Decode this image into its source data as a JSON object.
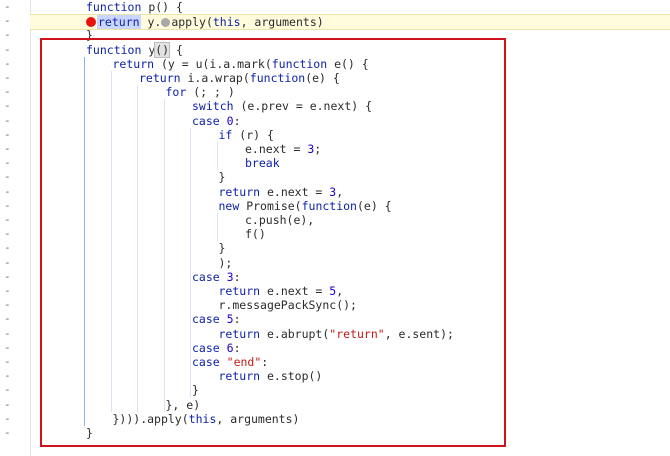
{
  "editor": {
    "gutter_marker": "-",
    "highlight_box_color": "#d0121f",
    "breakpoint_color": "#e8130f",
    "lines": [
      {
        "segments": [
          {
            "t": "function",
            "c": "kwb"
          },
          {
            "t": " p() {",
            "c": "fn"
          }
        ]
      },
      {
        "paused": true,
        "segments": [
          {
            "t": "return",
            "c": "hl-return"
          },
          {
            "t": " y.",
            "c": "fn"
          },
          {
            "t": "apply(",
            "c": "fn"
          },
          {
            "t": "this",
            "c": "kwb"
          },
          {
            "t": ", arguments)",
            "c": "fn"
          }
        ]
      },
      {
        "segments": [
          {
            "t": "}",
            "c": "fn"
          }
        ]
      },
      {
        "segments": [
          {
            "t": "function",
            "c": "kwb"
          },
          {
            "t": " y",
            "c": "fn"
          },
          {
            "t": "()",
            "c": "hl-paren"
          },
          {
            "t": " {",
            "c": "fn"
          }
        ]
      },
      {
        "segments": [
          {
            "t": "return",
            "c": "kwb"
          },
          {
            "t": " (y = u(i.a.mark(",
            "c": "fn"
          },
          {
            "t": "function",
            "c": "kwb"
          },
          {
            "t": " e() {",
            "c": "fn"
          }
        ]
      },
      {
        "segments": [
          {
            "t": "return",
            "c": "kwb"
          },
          {
            "t": " i.a.wrap(",
            "c": "fn"
          },
          {
            "t": "function",
            "c": "kwb"
          },
          {
            "t": "(e) {",
            "c": "fn"
          }
        ]
      },
      {
        "segments": [
          {
            "t": "for",
            "c": "kwb"
          },
          {
            "t": " (; ; )",
            "c": "fn"
          }
        ]
      },
      {
        "segments": [
          {
            "t": "switch",
            "c": "kwb"
          },
          {
            "t": " (e.prev = e.next) {",
            "c": "fn"
          }
        ]
      },
      {
        "segments": [
          {
            "t": "case",
            "c": "kwb"
          },
          {
            "t": " ",
            "c": "fn"
          },
          {
            "t": "0",
            "c": "num"
          },
          {
            "t": ":",
            "c": "fn"
          }
        ]
      },
      {
        "segments": [
          {
            "t": "if",
            "c": "kwb"
          },
          {
            "t": " (r) {",
            "c": "fn"
          }
        ]
      },
      {
        "segments": [
          {
            "t": "e.next = ",
            "c": "fn"
          },
          {
            "t": "3",
            "c": "num"
          },
          {
            "t": ";",
            "c": "fn"
          }
        ]
      },
      {
        "segments": [
          {
            "t": "break",
            "c": "kwb"
          }
        ]
      },
      {
        "segments": [
          {
            "t": "}",
            "c": "fn"
          }
        ]
      },
      {
        "segments": [
          {
            "t": "return",
            "c": "kwb"
          },
          {
            "t": " e.next = ",
            "c": "fn"
          },
          {
            "t": "3",
            "c": "num"
          },
          {
            "t": ",",
            "c": "fn"
          }
        ]
      },
      {
        "segments": [
          {
            "t": "new",
            "c": "kwb"
          },
          {
            "t": " Promise(",
            "c": "fn"
          },
          {
            "t": "function",
            "c": "kwb"
          },
          {
            "t": "(e) {",
            "c": "fn"
          }
        ]
      },
      {
        "segments": [
          {
            "t": "c.push(e),",
            "c": "fn"
          }
        ]
      },
      {
        "segments": [
          {
            "t": "f()",
            "c": "fn"
          }
        ]
      },
      {
        "segments": [
          {
            "t": "}",
            "c": "fn"
          }
        ]
      },
      {
        "segments": [
          {
            "t": ");",
            "c": "fn"
          }
        ]
      },
      {
        "segments": [
          {
            "t": "case",
            "c": "kwb"
          },
          {
            "t": " ",
            "c": "fn"
          },
          {
            "t": "3",
            "c": "num"
          },
          {
            "t": ":",
            "c": "fn"
          }
        ]
      },
      {
        "segments": [
          {
            "t": "return",
            "c": "kwb"
          },
          {
            "t": " e.next = ",
            "c": "fn"
          },
          {
            "t": "5",
            "c": "num"
          },
          {
            "t": ",",
            "c": "fn"
          }
        ]
      },
      {
        "segments": [
          {
            "t": "r.messagePackSync();",
            "c": "fn"
          }
        ]
      },
      {
        "segments": [
          {
            "t": "case",
            "c": "kwb"
          },
          {
            "t": " ",
            "c": "fn"
          },
          {
            "t": "5",
            "c": "num"
          },
          {
            "t": ":",
            "c": "fn"
          }
        ]
      },
      {
        "segments": [
          {
            "t": "return",
            "c": "kwb"
          },
          {
            "t": " e.abrupt(",
            "c": "fn"
          },
          {
            "t": "\"return\"",
            "c": "str"
          },
          {
            "t": ", e.sent);",
            "c": "fn"
          }
        ]
      },
      {
        "segments": [
          {
            "t": "case",
            "c": "kwb"
          },
          {
            "t": " ",
            "c": "fn"
          },
          {
            "t": "6",
            "c": "num"
          },
          {
            "t": ":",
            "c": "fn"
          }
        ]
      },
      {
        "segments": [
          {
            "t": "case",
            "c": "kwb"
          },
          {
            "t": " ",
            "c": "fn"
          },
          {
            "t": "\"end\"",
            "c": "str"
          },
          {
            "t": ":",
            "c": "fn"
          }
        ]
      },
      {
        "segments": [
          {
            "t": "return",
            "c": "kwb"
          },
          {
            "t": " e.stop()",
            "c": "fn"
          }
        ]
      },
      {
        "segments": [
          {
            "t": "}",
            "c": "fn"
          }
        ]
      },
      {
        "segments": [
          {
            "t": "}, e)",
            "c": "fn"
          }
        ]
      },
      {
        "segments": [
          {
            "t": "}))).apply(",
            "c": "fn"
          },
          {
            "t": "this",
            "c": "kwb"
          },
          {
            "t": ", arguments)",
            "c": "fn"
          }
        ]
      },
      {
        "segments": [
          {
            "t": "}",
            "c": "fn"
          }
        ]
      }
    ]
  }
}
